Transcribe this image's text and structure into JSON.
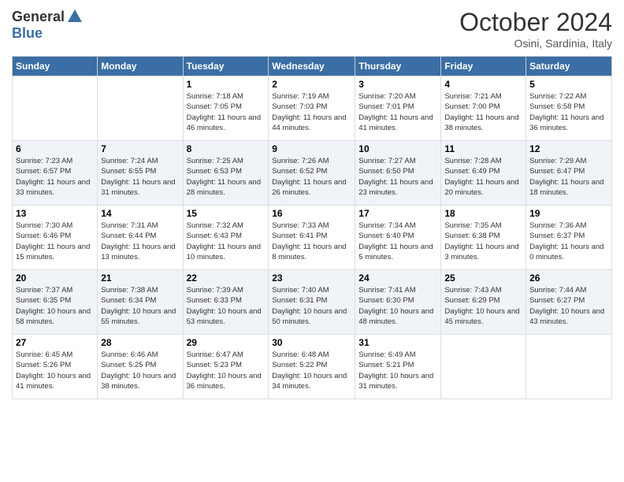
{
  "logo": {
    "general": "General",
    "blue": "Blue"
  },
  "header": {
    "month": "October 2024",
    "location": "Osini, Sardinia, Italy"
  },
  "days_of_week": [
    "Sunday",
    "Monday",
    "Tuesday",
    "Wednesday",
    "Thursday",
    "Friday",
    "Saturday"
  ],
  "weeks": [
    [
      {
        "num": "",
        "sunrise": "",
        "sunset": "",
        "daylight": ""
      },
      {
        "num": "",
        "sunrise": "",
        "sunset": "",
        "daylight": ""
      },
      {
        "num": "1",
        "sunrise": "Sunrise: 7:18 AM",
        "sunset": "Sunset: 7:05 PM",
        "daylight": "Daylight: 11 hours and 46 minutes."
      },
      {
        "num": "2",
        "sunrise": "Sunrise: 7:19 AM",
        "sunset": "Sunset: 7:03 PM",
        "daylight": "Daylight: 11 hours and 44 minutes."
      },
      {
        "num": "3",
        "sunrise": "Sunrise: 7:20 AM",
        "sunset": "Sunset: 7:01 PM",
        "daylight": "Daylight: 11 hours and 41 minutes."
      },
      {
        "num": "4",
        "sunrise": "Sunrise: 7:21 AM",
        "sunset": "Sunset: 7:00 PM",
        "daylight": "Daylight: 11 hours and 38 minutes."
      },
      {
        "num": "5",
        "sunrise": "Sunrise: 7:22 AM",
        "sunset": "Sunset: 6:58 PM",
        "daylight": "Daylight: 11 hours and 36 minutes."
      }
    ],
    [
      {
        "num": "6",
        "sunrise": "Sunrise: 7:23 AM",
        "sunset": "Sunset: 6:57 PM",
        "daylight": "Daylight: 11 hours and 33 minutes."
      },
      {
        "num": "7",
        "sunrise": "Sunrise: 7:24 AM",
        "sunset": "Sunset: 6:55 PM",
        "daylight": "Daylight: 11 hours and 31 minutes."
      },
      {
        "num": "8",
        "sunrise": "Sunrise: 7:25 AM",
        "sunset": "Sunset: 6:53 PM",
        "daylight": "Daylight: 11 hours and 28 minutes."
      },
      {
        "num": "9",
        "sunrise": "Sunrise: 7:26 AM",
        "sunset": "Sunset: 6:52 PM",
        "daylight": "Daylight: 11 hours and 26 minutes."
      },
      {
        "num": "10",
        "sunrise": "Sunrise: 7:27 AM",
        "sunset": "Sunset: 6:50 PM",
        "daylight": "Daylight: 11 hours and 23 minutes."
      },
      {
        "num": "11",
        "sunrise": "Sunrise: 7:28 AM",
        "sunset": "Sunset: 6:49 PM",
        "daylight": "Daylight: 11 hours and 20 minutes."
      },
      {
        "num": "12",
        "sunrise": "Sunrise: 7:29 AM",
        "sunset": "Sunset: 6:47 PM",
        "daylight": "Daylight: 11 hours and 18 minutes."
      }
    ],
    [
      {
        "num": "13",
        "sunrise": "Sunrise: 7:30 AM",
        "sunset": "Sunset: 6:46 PM",
        "daylight": "Daylight: 11 hours and 15 minutes."
      },
      {
        "num": "14",
        "sunrise": "Sunrise: 7:31 AM",
        "sunset": "Sunset: 6:44 PM",
        "daylight": "Daylight: 11 hours and 13 minutes."
      },
      {
        "num": "15",
        "sunrise": "Sunrise: 7:32 AM",
        "sunset": "Sunset: 6:43 PM",
        "daylight": "Daylight: 11 hours and 10 minutes."
      },
      {
        "num": "16",
        "sunrise": "Sunrise: 7:33 AM",
        "sunset": "Sunset: 6:41 PM",
        "daylight": "Daylight: 11 hours and 8 minutes."
      },
      {
        "num": "17",
        "sunrise": "Sunrise: 7:34 AM",
        "sunset": "Sunset: 6:40 PM",
        "daylight": "Daylight: 11 hours and 5 minutes."
      },
      {
        "num": "18",
        "sunrise": "Sunrise: 7:35 AM",
        "sunset": "Sunset: 6:38 PM",
        "daylight": "Daylight: 11 hours and 3 minutes."
      },
      {
        "num": "19",
        "sunrise": "Sunrise: 7:36 AM",
        "sunset": "Sunset: 6:37 PM",
        "daylight": "Daylight: 11 hours and 0 minutes."
      }
    ],
    [
      {
        "num": "20",
        "sunrise": "Sunrise: 7:37 AM",
        "sunset": "Sunset: 6:35 PM",
        "daylight": "Daylight: 10 hours and 58 minutes."
      },
      {
        "num": "21",
        "sunrise": "Sunrise: 7:38 AM",
        "sunset": "Sunset: 6:34 PM",
        "daylight": "Daylight: 10 hours and 55 minutes."
      },
      {
        "num": "22",
        "sunrise": "Sunrise: 7:39 AM",
        "sunset": "Sunset: 6:33 PM",
        "daylight": "Daylight: 10 hours and 53 minutes."
      },
      {
        "num": "23",
        "sunrise": "Sunrise: 7:40 AM",
        "sunset": "Sunset: 6:31 PM",
        "daylight": "Daylight: 10 hours and 50 minutes."
      },
      {
        "num": "24",
        "sunrise": "Sunrise: 7:41 AM",
        "sunset": "Sunset: 6:30 PM",
        "daylight": "Daylight: 10 hours and 48 minutes."
      },
      {
        "num": "25",
        "sunrise": "Sunrise: 7:43 AM",
        "sunset": "Sunset: 6:29 PM",
        "daylight": "Daylight: 10 hours and 45 minutes."
      },
      {
        "num": "26",
        "sunrise": "Sunrise: 7:44 AM",
        "sunset": "Sunset: 6:27 PM",
        "daylight": "Daylight: 10 hours and 43 minutes."
      }
    ],
    [
      {
        "num": "27",
        "sunrise": "Sunrise: 6:45 AM",
        "sunset": "Sunset: 5:26 PM",
        "daylight": "Daylight: 10 hours and 41 minutes."
      },
      {
        "num": "28",
        "sunrise": "Sunrise: 6:46 AM",
        "sunset": "Sunset: 5:25 PM",
        "daylight": "Daylight: 10 hours and 38 minutes."
      },
      {
        "num": "29",
        "sunrise": "Sunrise: 6:47 AM",
        "sunset": "Sunset: 5:23 PM",
        "daylight": "Daylight: 10 hours and 36 minutes."
      },
      {
        "num": "30",
        "sunrise": "Sunrise: 6:48 AM",
        "sunset": "Sunset: 5:22 PM",
        "daylight": "Daylight: 10 hours and 34 minutes."
      },
      {
        "num": "31",
        "sunrise": "Sunrise: 6:49 AM",
        "sunset": "Sunset: 5:21 PM",
        "daylight": "Daylight: 10 hours and 31 minutes."
      },
      {
        "num": "",
        "sunrise": "",
        "sunset": "",
        "daylight": ""
      },
      {
        "num": "",
        "sunrise": "",
        "sunset": "",
        "daylight": ""
      }
    ]
  ]
}
